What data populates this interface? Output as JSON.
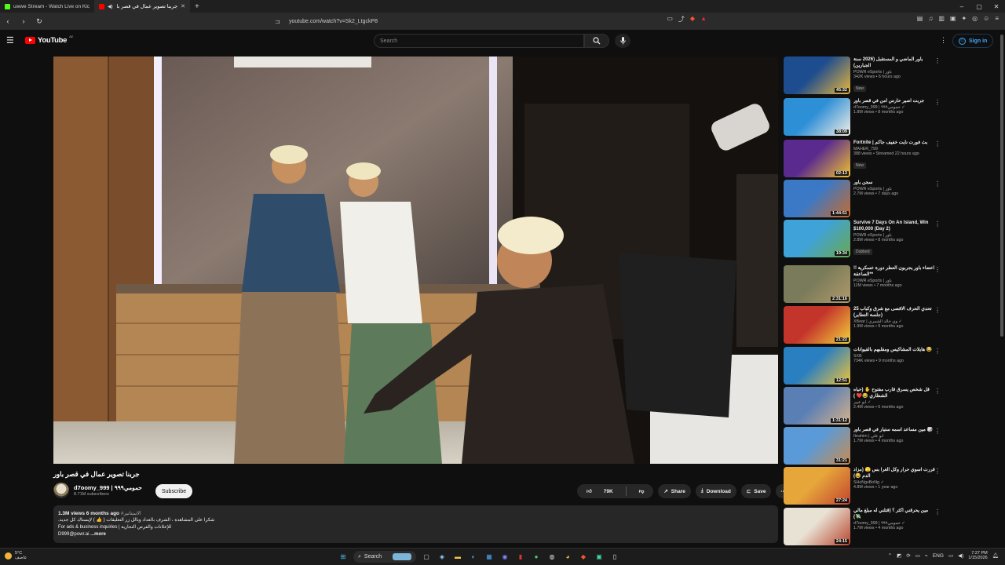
{
  "browser": {
    "tabs": [
      {
        "title": "uwwe Stream - Watch Live on Kick",
        "active": false,
        "favicon_color": "#53fc18"
      },
      {
        "title": "جربنا تصوير عمال في قصر باور",
        "active": true,
        "favicon_color": "#ff0000"
      }
    ],
    "new_tab": "+",
    "url": "youtube.com/watch?v=Sk2_LtgckP8",
    "window_controls": [
      "–",
      "▢",
      "✕"
    ]
  },
  "youtube": {
    "logo_text": "YouTube",
    "logo_region": "AE",
    "search_placeholder": "Search",
    "sign_in": "Sign in"
  },
  "video": {
    "title": "جربنا تصوير عمال في قصر باور",
    "channel_name": "d7oomy_999 | حمومي٩٩٩",
    "subscribers": "8.71M subscribers",
    "subscribe_label": "Subscribe",
    "likes": "79K",
    "share_label": "Share",
    "download_label": "Download",
    "save_label": "Save",
    "description": {
      "meta": "1.3M views  6 months ago",
      "hashtag": "#الاستانير",
      "line1": "شكرا على المشاهدة ، الشرف بالعداد وبالل زر التعليقات ( 👍 ) لإيستاك كل جديد.",
      "line2": "For ads & business inquiries | للإعلانات والفرص التجارية",
      "line3": "D999@powr.ai",
      "more": "...more"
    }
  },
  "recommendations": [
    {
      "title": "باور الماضي و المستقبل (2026 سنة الجبارين)",
      "channel": "POWR eSports | باور",
      "stats": "342K views • 6 hours ago",
      "badge": "New",
      "duration": "45:32",
      "colors": [
        "#1d4c8f",
        "#e8b73a"
      ]
    },
    {
      "title": "جربت اصير حارس امن في قصر باور",
      "channel": "d7oomy_999 | حمومي٩٩٩ ✓",
      "stats": "1.8M views • 8 months ago",
      "badge": "",
      "duration": "38:09",
      "colors": [
        "#2d8fd6",
        "#f5f0e6"
      ]
    },
    {
      "title": "Fortnite | بث فورت نايت خفيف جاكم",
      "channel": "MAHER_799",
      "stats": "388 views • Streamed 22 hours ago",
      "badge": "New",
      "duration": "02:13",
      "colors": [
        "#5a2a8f",
        "#f2c22f"
      ]
    },
    {
      "title": "سجن باور",
      "channel": "POWR eSports | باور",
      "stats": "2.7M views • 7 days ago",
      "badge": "",
      "duration": "1:44:51",
      "colors": [
        "#3b79c7",
        "#c96a2a"
      ]
    },
    {
      "title": "Survive 7 Days On An Island, Win $100,000 (Day 2)",
      "channel": "POWR eSports | باور",
      "stats": "2.8M views • 8 months ago",
      "badge": "Dubbed",
      "duration": "19:34",
      "colors": [
        "#3fa2d8",
        "#6aa84f"
      ]
    },
    {
      "title": "اعضاء باور يجربون العطر دورة عسكرية !! *الصاعقة*",
      "channel": "POWR eSports | باور",
      "stats": "11M views • 7 months ago",
      "badge": "",
      "duration": "2:31:16",
      "colors": [
        "#7a7b5a",
        "#b09a6a"
      ]
    },
    {
      "title": "تحدي الحرف الاقصى مع شرق وكباب 25 (جلسة التطاير)",
      "channel": "XBear | وي خالد الشمري ✓",
      "stats": "1.9M views • 9 months ago",
      "badge": "",
      "duration": "21:22",
      "colors": [
        "#c3342b",
        "#f3d23a"
      ]
    },
    {
      "title": "هايلات المشاكيس ومقلبهم بالقيوانات 😂",
      "channel": "SXB",
      "stats": "734K views • 9 months ago",
      "badge": "",
      "duration": "12:51",
      "colors": [
        "#2a7fc0",
        "#f0c33a"
      ]
    },
    {
      "title": "قل شخص يسرق قارب مفتوح ✋ (حياه الشطاري 😂❤️ )",
      "channel": "ابو عبير ✓",
      "stats": "2.4M views • 6 months ago",
      "badge": "",
      "duration": "1:31:12",
      "colors": [
        "#5a7fb5",
        "#d6b28a"
      ]
    },
    {
      "title": "مين مساعد اسمه ستيار في قصر باور 🎲",
      "channel": "Ibrahim | ابو علي",
      "stats": "1.7M views • 4 months ago",
      "badge": "",
      "duration": "31:21",
      "colors": [
        "#5a9ad8",
        "#c88c4f"
      ]
    },
    {
      "title": "قررت اسوي حرار وكل الغرا بس 🫣 (مزاد الدم 😂)",
      "channel": "SHoNgxBoNg ✓",
      "stats": "4.8M views • 1 year ago",
      "badge": "",
      "duration": "27:24",
      "colors": [
        "#e7a63a",
        "#c1442f"
      ]
    },
    {
      "title": "مين يحرقني اكثر ؟ (قتلني له مبلغ مالي 💸)",
      "channel": "d7oomy_999 | حمومي٩٩٩ ✓",
      "stats": "1.7M views • 4 months ago",
      "badge": "",
      "duration": "24:15",
      "colors": [
        "#e8e2d4",
        "#b8452c"
      ]
    }
  ],
  "taskbar": {
    "weather_temp": "5°C",
    "weather_desc": "عاصف",
    "search_label": "Search",
    "language": "ENG",
    "time": "7:27 PM",
    "date": "1/15/2026"
  }
}
